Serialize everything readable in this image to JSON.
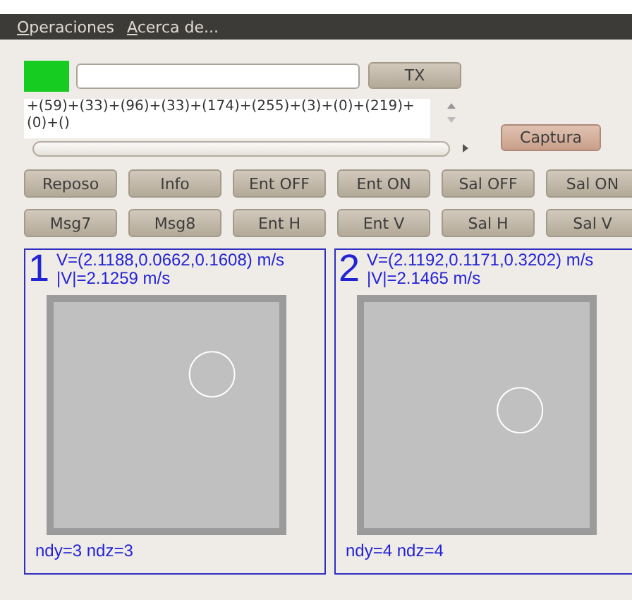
{
  "menu": [
    {
      "label": "Operaciones"
    },
    {
      "label": "Acerca de..."
    }
  ],
  "status_indicator": {
    "color": "#17cc20"
  },
  "send_button": "TX",
  "log": {
    "text": "+(59)+(33)+(96)+(33)+(174)+(255)+(3)+(0)+(219)+(0)+()"
  },
  "capture_button": "Captura",
  "command_buttons": [
    [
      "Reposo",
      "Info",
      "Ent OFF",
      "Ent ON",
      "Sal OFF",
      "Sal ON"
    ],
    [
      "Msg7",
      "Msg8",
      "Ent H",
      "Ent V",
      "Sal H",
      "Sal V"
    ]
  ],
  "sensors": [
    {
      "number": "1",
      "velocity": "V=(2.1188,0.0662,0.1608) m/s",
      "speed": "|V|=2.1259 m/s",
      "footer": "ndy=3 ndz=3"
    },
    {
      "number": "2",
      "velocity": "V=(2.1192,0.1171,0.3202) m/s",
      "speed": "|V|=2.1465 m/s",
      "footer": "ndy=4 ndz=4"
    }
  ]
}
